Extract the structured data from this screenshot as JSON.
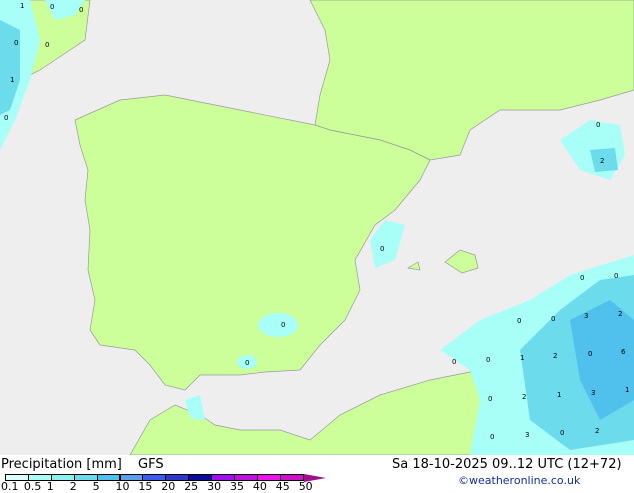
{
  "title": "Precipitation [mm]",
  "model": "GFS",
  "datetime": "Sa 18-10-2025 09..12 UTC (12+72)",
  "credit": "©weatheronline.co.uk",
  "colors": {
    "land": "#ccff99",
    "sea": "#eeeeee",
    "border": "#999999"
  },
  "scale": {
    "labels": [
      "0.1",
      "0.5",
      "1",
      "2",
      "5",
      "10",
      "15",
      "20",
      "25",
      "30",
      "35",
      "40",
      "45",
      "50"
    ],
    "colors": [
      "#ddfffc",
      "#a8fff8",
      "#8cf0ec",
      "#6cdcec",
      "#50c0ec",
      "#5aa0e8",
      "#3c5cf0",
      "#2c38c8",
      "#0c0ca0",
      "#a010f0",
      "#c010e0",
      "#f010f0",
      "#d010c8"
    ]
  },
  "map_values": [
    {
      "v": "1"
    },
    {
      "v": "0"
    },
    {
      "v": "0"
    },
    {
      "v": "0"
    },
    {
      "v": "0"
    },
    {
      "v": "1"
    },
    {
      "v": "0"
    },
    {
      "v": "0"
    },
    {
      "v": "2"
    },
    {
      "v": "0"
    },
    {
      "v": "0"
    },
    {
      "v": "0"
    },
    {
      "v": "0"
    },
    {
      "v": "0"
    },
    {
      "v": "0"
    },
    {
      "v": "3"
    },
    {
      "v": "2"
    },
    {
      "v": "0"
    },
    {
      "v": "0"
    },
    {
      "v": "1"
    },
    {
      "v": "2"
    },
    {
      "v": "0"
    },
    {
      "v": "6"
    },
    {
      "v": "0"
    },
    {
      "v": "2"
    },
    {
      "v": "1"
    },
    {
      "v": "3"
    },
    {
      "v": "1"
    },
    {
      "v": "0"
    },
    {
      "v": "3"
    },
    {
      "v": "0"
    },
    {
      "v": "2"
    },
    {
      "v": "0"
    }
  ]
}
